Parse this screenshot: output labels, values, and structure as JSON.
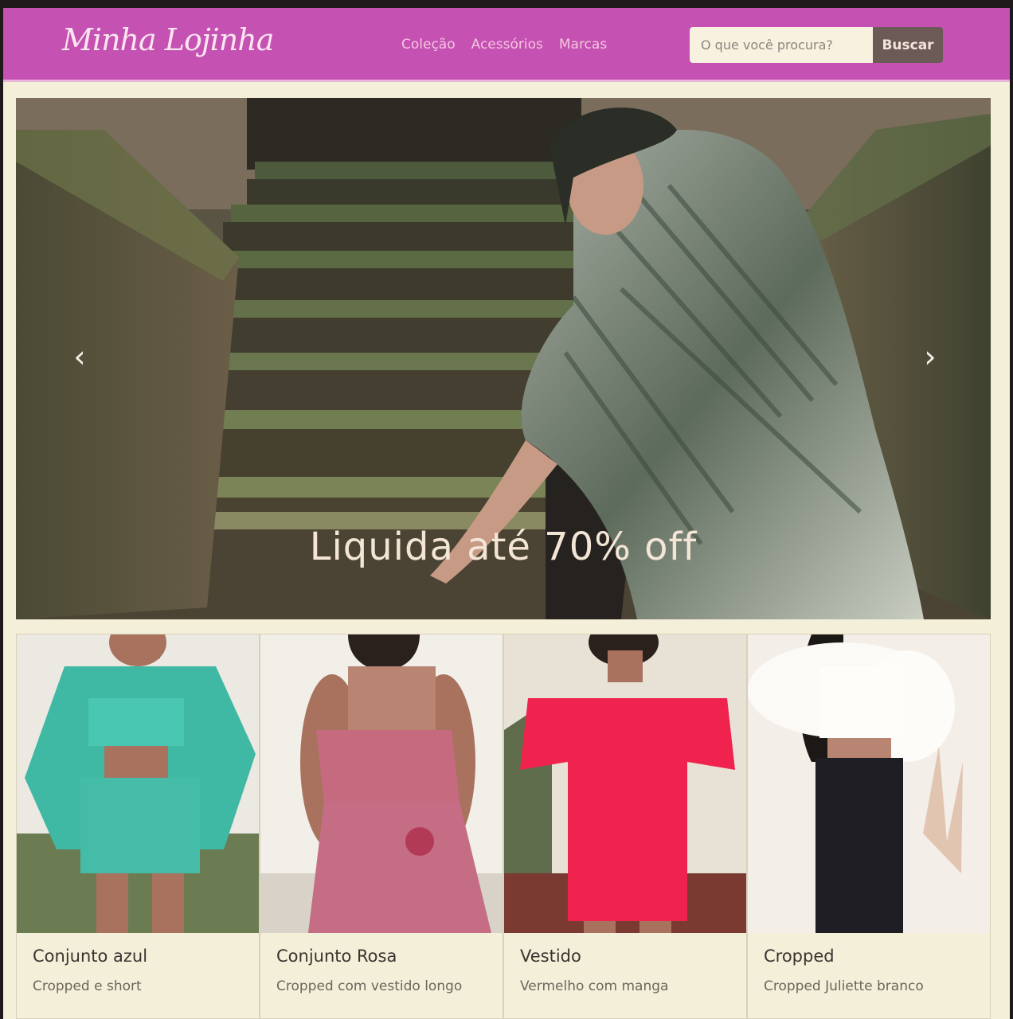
{
  "header": {
    "brand": "Minha Lojinha",
    "nav": [
      "Coleção",
      "Acessórios",
      "Marcas"
    ],
    "search_placeholder": "O que você procura?",
    "search_button": "Buscar"
  },
  "carousel": {
    "caption": "Liquida até 70% off",
    "prev_icon": "chevron-left-icon",
    "next_icon": "chevron-right-icon"
  },
  "products": [
    {
      "title": "Conjunto azul",
      "text": "Cropped e short",
      "accent": "#3fb8a4"
    },
    {
      "title": "Conjunto Rosa",
      "text": "Cropped com vestido longo",
      "accent": "#c66a80"
    },
    {
      "title": "Vestido",
      "text": "Vermelho com manga",
      "accent": "#f0234e"
    },
    {
      "title": "Cropped",
      "text": "Cropped Juliette branco",
      "accent": "#f6f3ec"
    }
  ],
  "colors": {
    "navbar": "#c551b3",
    "page_background": "#f4efd9",
    "search_button": "#6b5a55"
  }
}
